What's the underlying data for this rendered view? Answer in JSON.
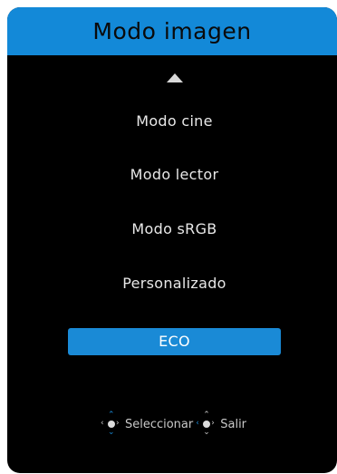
{
  "header": {
    "title": "Modo imagen"
  },
  "menu": {
    "items": [
      {
        "label": "Modo cine"
      },
      {
        "label": "Modo lector"
      },
      {
        "label": "Modo sRGB"
      },
      {
        "label": "Personalizado"
      },
      {
        "label": "ECO",
        "selected": true
      }
    ]
  },
  "hints": {
    "select_label": "Seleccionar",
    "exit_label": "Salir"
  },
  "icons": {
    "scroll_up": "triangle-up-icon",
    "joystick": "joystick-icon"
  },
  "colors": {
    "accent": "#1a8ad6",
    "header": "#1389d8",
    "panel": "#000000"
  }
}
